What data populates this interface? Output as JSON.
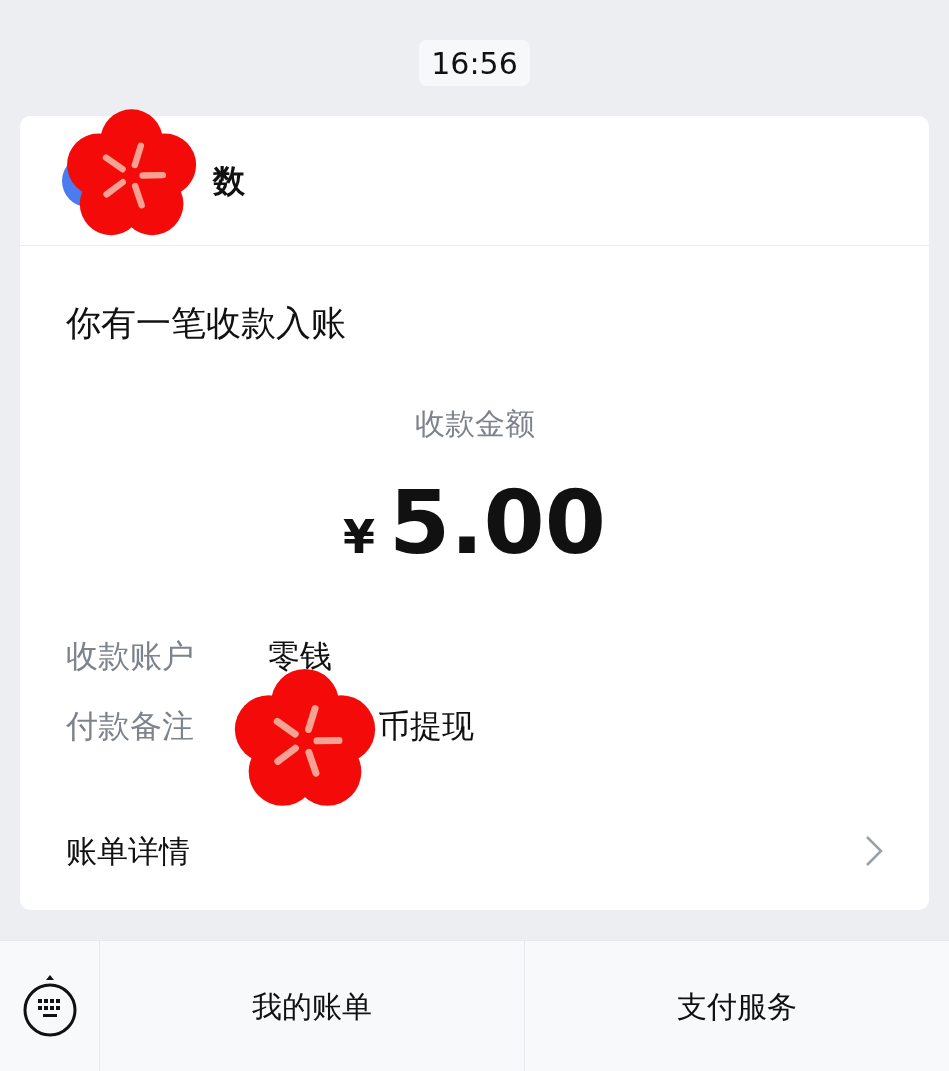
{
  "time": "16:56",
  "header": {
    "name": "数"
  },
  "title": "你有一笔收款入账",
  "amount_label": "收款金额",
  "amount": {
    "currency": "¥",
    "value": "5.00"
  },
  "details": [
    {
      "label": "收款账户",
      "value": "零钱",
      "covered": false
    },
    {
      "label": "付款备注",
      "value": "币提现",
      "covered": true
    }
  ],
  "link": "账单详情",
  "menu": [
    {
      "label": "我的账单"
    },
    {
      "label": "支付服务"
    }
  ]
}
